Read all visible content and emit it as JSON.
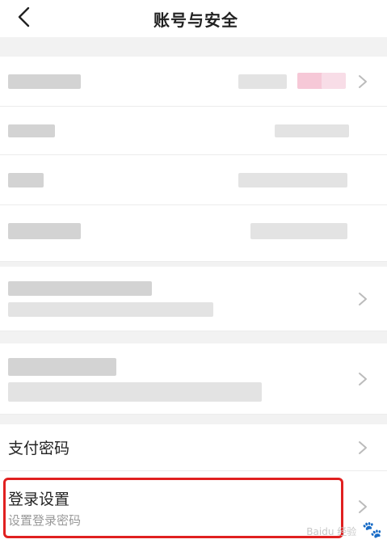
{
  "header": {
    "title": "账号与安全"
  },
  "rows": [
    {
      "id": "payment-password",
      "label": "支付密码"
    },
    {
      "id": "login-settings",
      "label": "登录设置",
      "sublabel": "设置登录密码"
    }
  ],
  "watermark": {
    "text": "Baidu 经验",
    "url": "jingyan.baidu.com"
  },
  "icons": {
    "back": "chevron-left-icon",
    "row_arrow": "chevron-right-icon"
  },
  "colors": {
    "highlight": "#e02020",
    "background": "#f2f2f2"
  }
}
